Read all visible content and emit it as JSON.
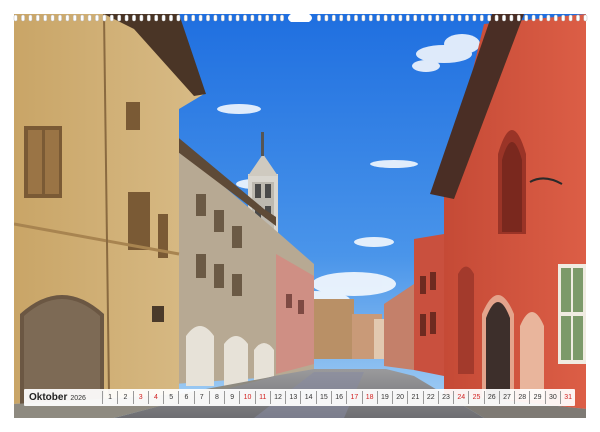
{
  "calendar": {
    "month": "Oktober",
    "year": "2026",
    "days": [
      {
        "n": "1",
        "red": false
      },
      {
        "n": "2",
        "red": false
      },
      {
        "n": "3",
        "red": true
      },
      {
        "n": "4",
        "red": true
      },
      {
        "n": "5",
        "red": false
      },
      {
        "n": "6",
        "red": false
      },
      {
        "n": "7",
        "red": false
      },
      {
        "n": "8",
        "red": false
      },
      {
        "n": "9",
        "red": false
      },
      {
        "n": "10",
        "red": true
      },
      {
        "n": "11",
        "red": true
      },
      {
        "n": "12",
        "red": false
      },
      {
        "n": "13",
        "red": false
      },
      {
        "n": "14",
        "red": false
      },
      {
        "n": "15",
        "red": false
      },
      {
        "n": "16",
        "red": false
      },
      {
        "n": "17",
        "red": true
      },
      {
        "n": "18",
        "red": true
      },
      {
        "n": "19",
        "red": false
      },
      {
        "n": "20",
        "red": false
      },
      {
        "n": "21",
        "red": false
      },
      {
        "n": "22",
        "red": false
      },
      {
        "n": "23",
        "red": false
      },
      {
        "n": "24",
        "red": true
      },
      {
        "n": "25",
        "red": true
      },
      {
        "n": "26",
        "red": false
      },
      {
        "n": "27",
        "red": false
      },
      {
        "n": "28",
        "red": false
      },
      {
        "n": "29",
        "red": false
      },
      {
        "n": "30",
        "red": false
      },
      {
        "n": "31",
        "red": true
      }
    ]
  },
  "colors": {
    "weekend_red": "#d22222",
    "sky_top": "#1f6fe0",
    "sky_bottom": "#8ec3f2",
    "left_facade": "#d4b073",
    "right_facade": "#d4553f"
  },
  "icons": [
    "wire-binding-icon",
    "hanger-hole-icon"
  ]
}
